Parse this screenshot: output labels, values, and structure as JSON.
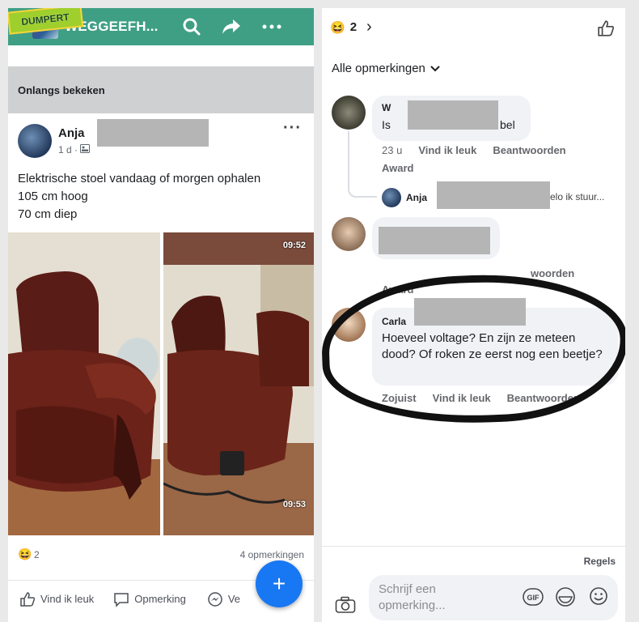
{
  "left": {
    "sticker_text": "DUMPERT",
    "group_title": "WEGGEEFH...",
    "section_label": "Onlangs bekeken",
    "post": {
      "author": "Anja",
      "meta": "1 d ·",
      "text_lines": [
        "Elektrische stoel vandaag of morgen ophalen",
        "105 cm hoog",
        "70 cm diep"
      ],
      "video1_time": "09:52",
      "video2_time": "09:53",
      "reaction_count": "2",
      "comment_count": "4 opmerkingen"
    },
    "actions": {
      "like": "Vind ik leuk",
      "comment": "Opmerking",
      "share": "Ve"
    },
    "fab": "+"
  },
  "right": {
    "reaction_count": "2",
    "filter_label": "Alle opmerkingen",
    "comments": [
      {
        "name": "W",
        "text_start": "Is",
        "text_end": "bel",
        "time": "23 u",
        "like": "Vind ik leuk",
        "reply": "Beantwoorden",
        "award": "Award"
      },
      {
        "award": "Award",
        "reply_partial": "woorden"
      },
      {
        "name": "Carla",
        "text": "Hoeveel voltage? En zijn ze meteen dood? Of roken ze eerst nog een beetje?",
        "time": "Zojuist",
        "like": "Vind ik leuk",
        "reply": "Beantwoorden"
      }
    ],
    "reply_preview": {
      "name": "Anja",
      "text_end": "elo ik stuur..."
    },
    "rules": "Regels",
    "composer_placeholder": "Schrijf een opmerking..."
  }
}
